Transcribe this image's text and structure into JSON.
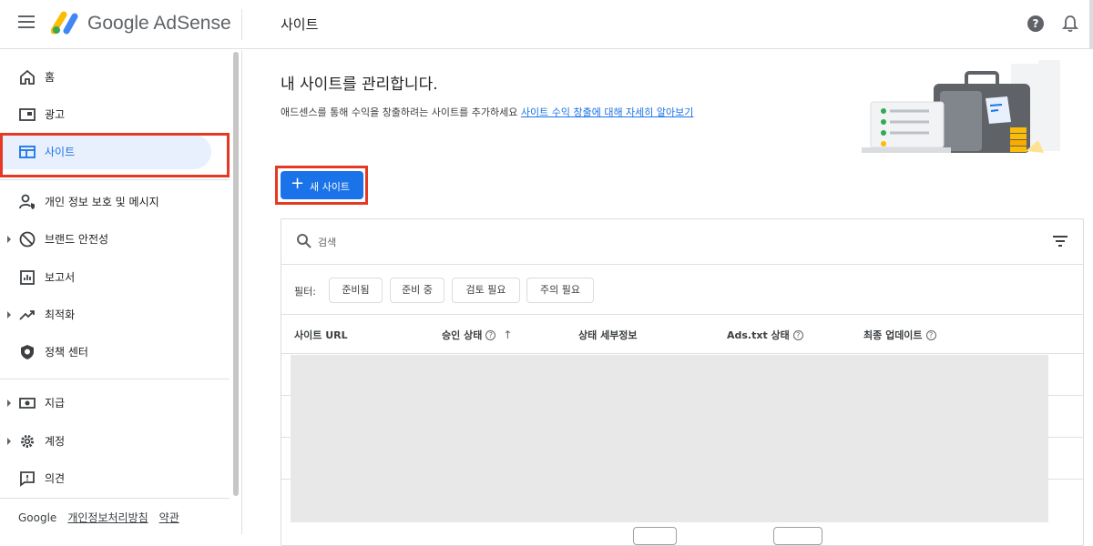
{
  "header": {
    "brand": "Google AdSense",
    "page_title": "사이트",
    "help_glyph": "?"
  },
  "sidebar": {
    "items": [
      {
        "label": "홈",
        "icon": "home-icon"
      },
      {
        "label": "광고",
        "icon": "ads-icon"
      },
      {
        "label": "사이트",
        "icon": "sites-icon",
        "active": true
      },
      {
        "label": "개인 정보 보호 및 메시지",
        "icon": "privacy-messaging-icon"
      },
      {
        "label": "브랜드 안전성",
        "icon": "block-icon",
        "expandable": true
      },
      {
        "label": "보고서",
        "icon": "reports-icon"
      },
      {
        "label": "최적화",
        "icon": "trending-up-icon",
        "expandable": true
      },
      {
        "label": "정책 센터",
        "icon": "policy-shield-icon"
      },
      {
        "label": "지급",
        "icon": "payments-icon",
        "expandable": true
      },
      {
        "label": "계정",
        "icon": "gear-icon",
        "expandable": true
      },
      {
        "label": "의견",
        "icon": "feedback-icon"
      }
    ],
    "footer": {
      "google": "Google",
      "privacy": "개인정보처리방침",
      "terms": "약관"
    }
  },
  "main": {
    "heading": "내 사이트를 관리합니다.",
    "description": "애드센스를 통해 수익을 창출하려는 사이트를 추가하세요",
    "learn_more_link": "사이트 수익 창출에 대해 자세히 알아보기",
    "new_site_button": "새 사이트",
    "search_placeholder": "검색",
    "filter_label": "필터:",
    "filter_chips": [
      "준비됨",
      "준비 중",
      "검토 필요",
      "주의 필요"
    ],
    "table_headers": [
      "사이트 URL",
      "승인 상태",
      "상태 세부정보",
      "Ads.txt 상태",
      "최종 업데이트"
    ],
    "sort_arrow": "↑",
    "help_glyph": "?"
  },
  "colors": {
    "accent": "#1a73e8",
    "active_bg": "#e8f0fe",
    "highlight_box": "#e53923",
    "redacted": "#e8e8e8"
  }
}
